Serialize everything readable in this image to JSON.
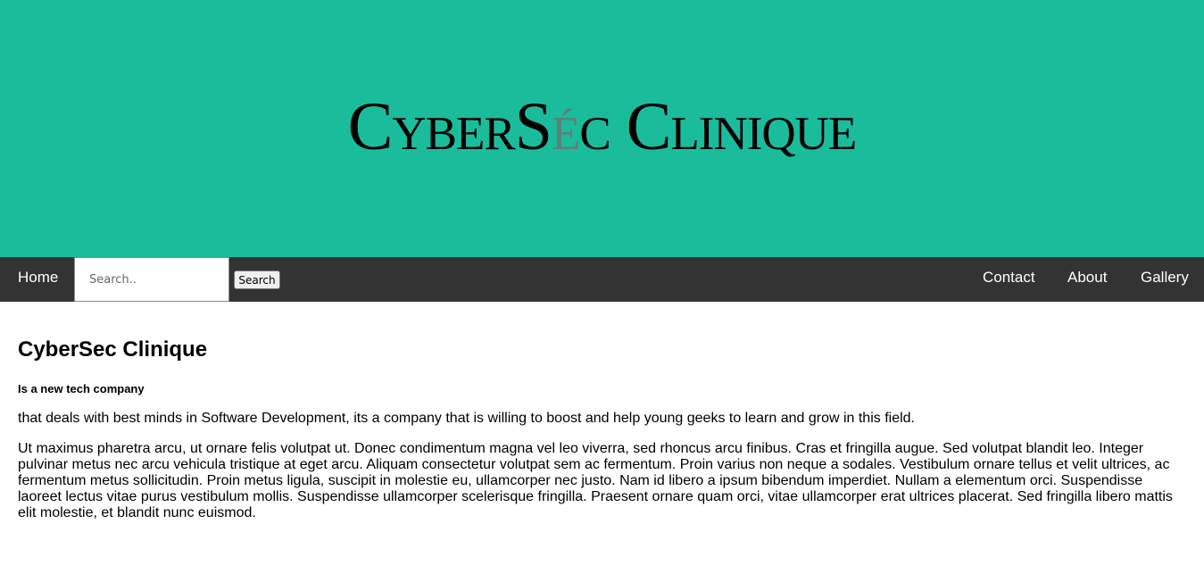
{
  "header": {
    "logo_part1": "CyberS",
    "logo_accent": "é",
    "logo_part2": "c Clinique"
  },
  "navbar": {
    "home": "Home",
    "search_placeholder": "Search..",
    "search_button": "Search",
    "contact": "Contact",
    "about": "About",
    "gallery": "Gallery"
  },
  "main": {
    "title": "CyberSec Clinique",
    "subtitle": "Is a new tech company",
    "intro": "that deals with best minds in Software Development, its a company that is willing to boost and help young geeks to learn and grow in this field.",
    "body": "Ut maximus pharetra arcu, ut ornare felis volutpat ut. Donec condimentum magna vel leo viverra, sed rhoncus arcu finibus. Cras et fringilla augue. Sed volutpat blandit leo. Integer pulvinar metus nec arcu vehicula tristique at eget arcu. Aliquam consectetur volutpat sem ac fermentum. Proin varius non neque a sodales. Vestibulum ornare tellus et velit ultrices, ac fermentum metus sollicitudin. Proin metus ligula, suscipit in molestie eu, ullamcorper nec justo. Nam id libero a ipsum bibendum imperdiet. Nullam a elementum orci. Suspendisse laoreet lectus vitae purus vestibulum mollis. Suspendisse ullamcorper scelerisque fringilla. Praesent ornare quam orci, vitae ullamcorper erat ultrices placerat. Sed fringilla libero mattis elit molestie, et blandit nunc euismod."
  },
  "colors": {
    "hero_background": "#1abc9c",
    "navbar_background": "#333333",
    "logo_accent": "#5f7f78"
  }
}
